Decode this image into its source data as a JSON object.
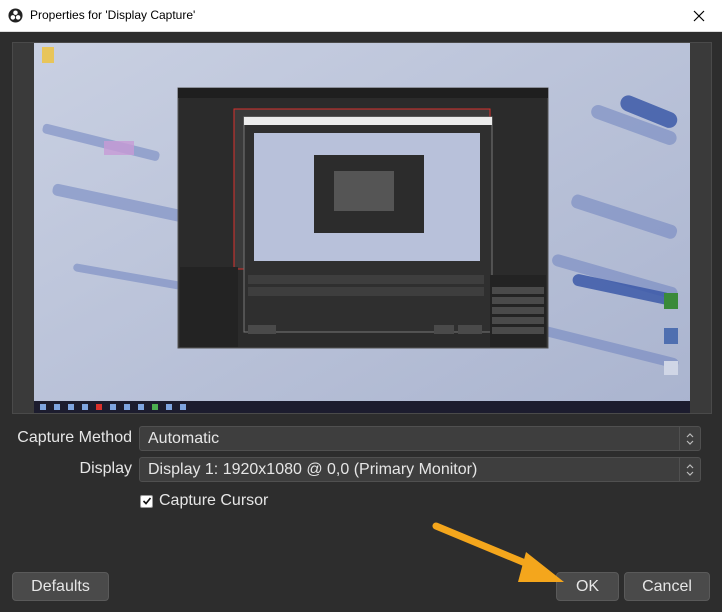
{
  "window": {
    "title": "Properties for 'Display Capture'"
  },
  "form": {
    "capture_method": {
      "label": "Capture Method",
      "value": "Automatic"
    },
    "display": {
      "label": "Display",
      "value": "Display 1: 1920x1080 @ 0,0 (Primary Monitor)"
    },
    "capture_cursor": {
      "label": "Capture Cursor",
      "checked": true
    }
  },
  "buttons": {
    "defaults": "Defaults",
    "ok": "OK",
    "cancel": "Cancel"
  },
  "colors": {
    "accent_arrow": "#f4a61c",
    "dialog_bg": "#2d2d2d",
    "control_bg": "#3e3e3e"
  }
}
